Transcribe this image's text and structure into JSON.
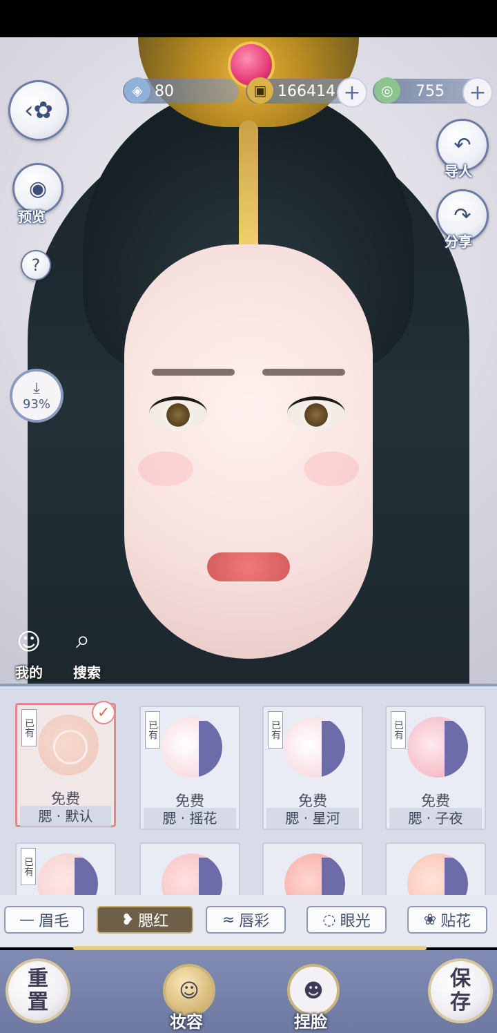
{
  "currency": [
    {
      "icon": "gem-icon",
      "value": "80",
      "has_plus": false
    },
    {
      "icon": "coin-icon",
      "value": "166414",
      "has_plus": true
    },
    {
      "icon": "jade-icon",
      "value": "755",
      "has_plus": true
    }
  ],
  "left_tools": {
    "preview_label": "预览",
    "download_percent": "93%"
  },
  "right_tools": {
    "import_label": "导人",
    "share_label": "分享"
  },
  "lower_left": {
    "mine_label": "我的",
    "search_label": "搜索"
  },
  "grid": {
    "items": [
      {
        "price": "免费",
        "name": "腮 · 默认",
        "owned": "已有",
        "selected": true
      },
      {
        "price": "免费",
        "name": "腮 · 摇花",
        "owned": "已有",
        "selected": false
      },
      {
        "price": "免费",
        "name": "腮 · 星河",
        "owned": "已有",
        "selected": false
      },
      {
        "price": "免费",
        "name": "腮 · 子夜",
        "owned": "已有",
        "selected": false
      },
      {
        "price": "",
        "name": "",
        "owned": "已有",
        "selected": false
      },
      {
        "price": "",
        "name": "",
        "owned": "",
        "selected": false
      },
      {
        "price": "",
        "name": "",
        "owned": "",
        "selected": false
      },
      {
        "price": "",
        "name": "",
        "owned": "",
        "selected": false
      }
    ]
  },
  "tabs": {
    "items": [
      {
        "label": "眉毛"
      },
      {
        "label": "腮红"
      },
      {
        "label": "唇彩"
      },
      {
        "label": "眼光"
      },
      {
        "label": "贴花"
      }
    ],
    "active_index": 1
  },
  "footer": {
    "reset_line1": "重",
    "reset_line2": "置",
    "save_line1": "保",
    "save_line2": "存",
    "makeup_label": "妆容",
    "face_label": "捏脸"
  },
  "colors": {
    "accent": "#6e79a1",
    "active_tab": "#6d5f48",
    "selected_border": "#e48786"
  }
}
